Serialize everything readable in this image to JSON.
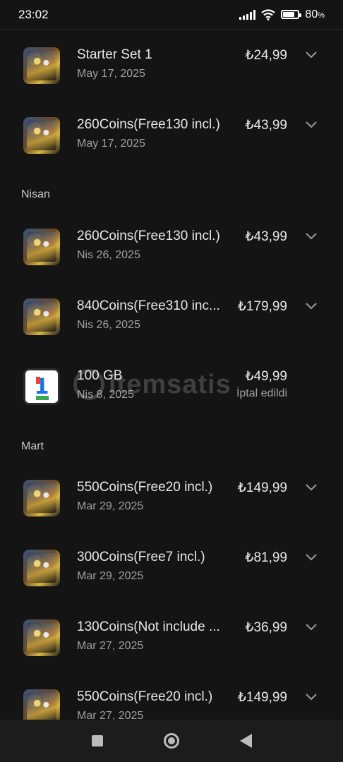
{
  "status_bar": {
    "time": "23:02",
    "battery_percent": "80",
    "battery_unit": "%",
    "battery_level": 0.8
  },
  "sections": [
    {
      "label": "Nisan"
    },
    {
      "label": "Mart"
    }
  ],
  "items": [
    {
      "title": "Starter Set 1",
      "date": "May 17, 2025",
      "price": "₺24,99",
      "icon": "game-thumbnail-icon"
    },
    {
      "title": "260Coins(Free130 incl.)",
      "date": "May 17, 2025",
      "price": "₺43,99",
      "icon": "game-thumbnail-icon"
    },
    {
      "title": "260Coins(Free130 incl.)",
      "date": "Nis 26, 2025",
      "price": "₺43,99",
      "icon": "game-thumbnail-icon"
    },
    {
      "title": "840Coins(Free310 inc...",
      "date": "Nis 26, 2025",
      "price": "₺179,99",
      "icon": "game-thumbnail-icon"
    },
    {
      "title": "100 GB",
      "date": "Nis 8, 2025",
      "price": "₺49,99",
      "status": "İptal edildi",
      "icon": "google-one-icon"
    },
    {
      "title": "550Coins(Free20 incl.)",
      "date": "Mar 29, 2025",
      "price": "₺149,99",
      "icon": "game-thumbnail-icon"
    },
    {
      "title": "300Coins(Free7 incl.)",
      "date": "Mar 29, 2025",
      "price": "₺81,99",
      "icon": "game-thumbnail-icon"
    },
    {
      "title": "130Coins(Not include ...",
      "date": "Mar 27, 2025",
      "price": "₺36,99",
      "icon": "game-thumbnail-icon"
    },
    {
      "title": "550Coins(Free20 incl.)",
      "date": "Mar 27, 2025",
      "price": "₺149,99",
      "icon": "game-thumbnail-icon"
    }
  ],
  "watermark": {
    "text": "itemsatis"
  },
  "google_one": {
    "digit": "1"
  }
}
